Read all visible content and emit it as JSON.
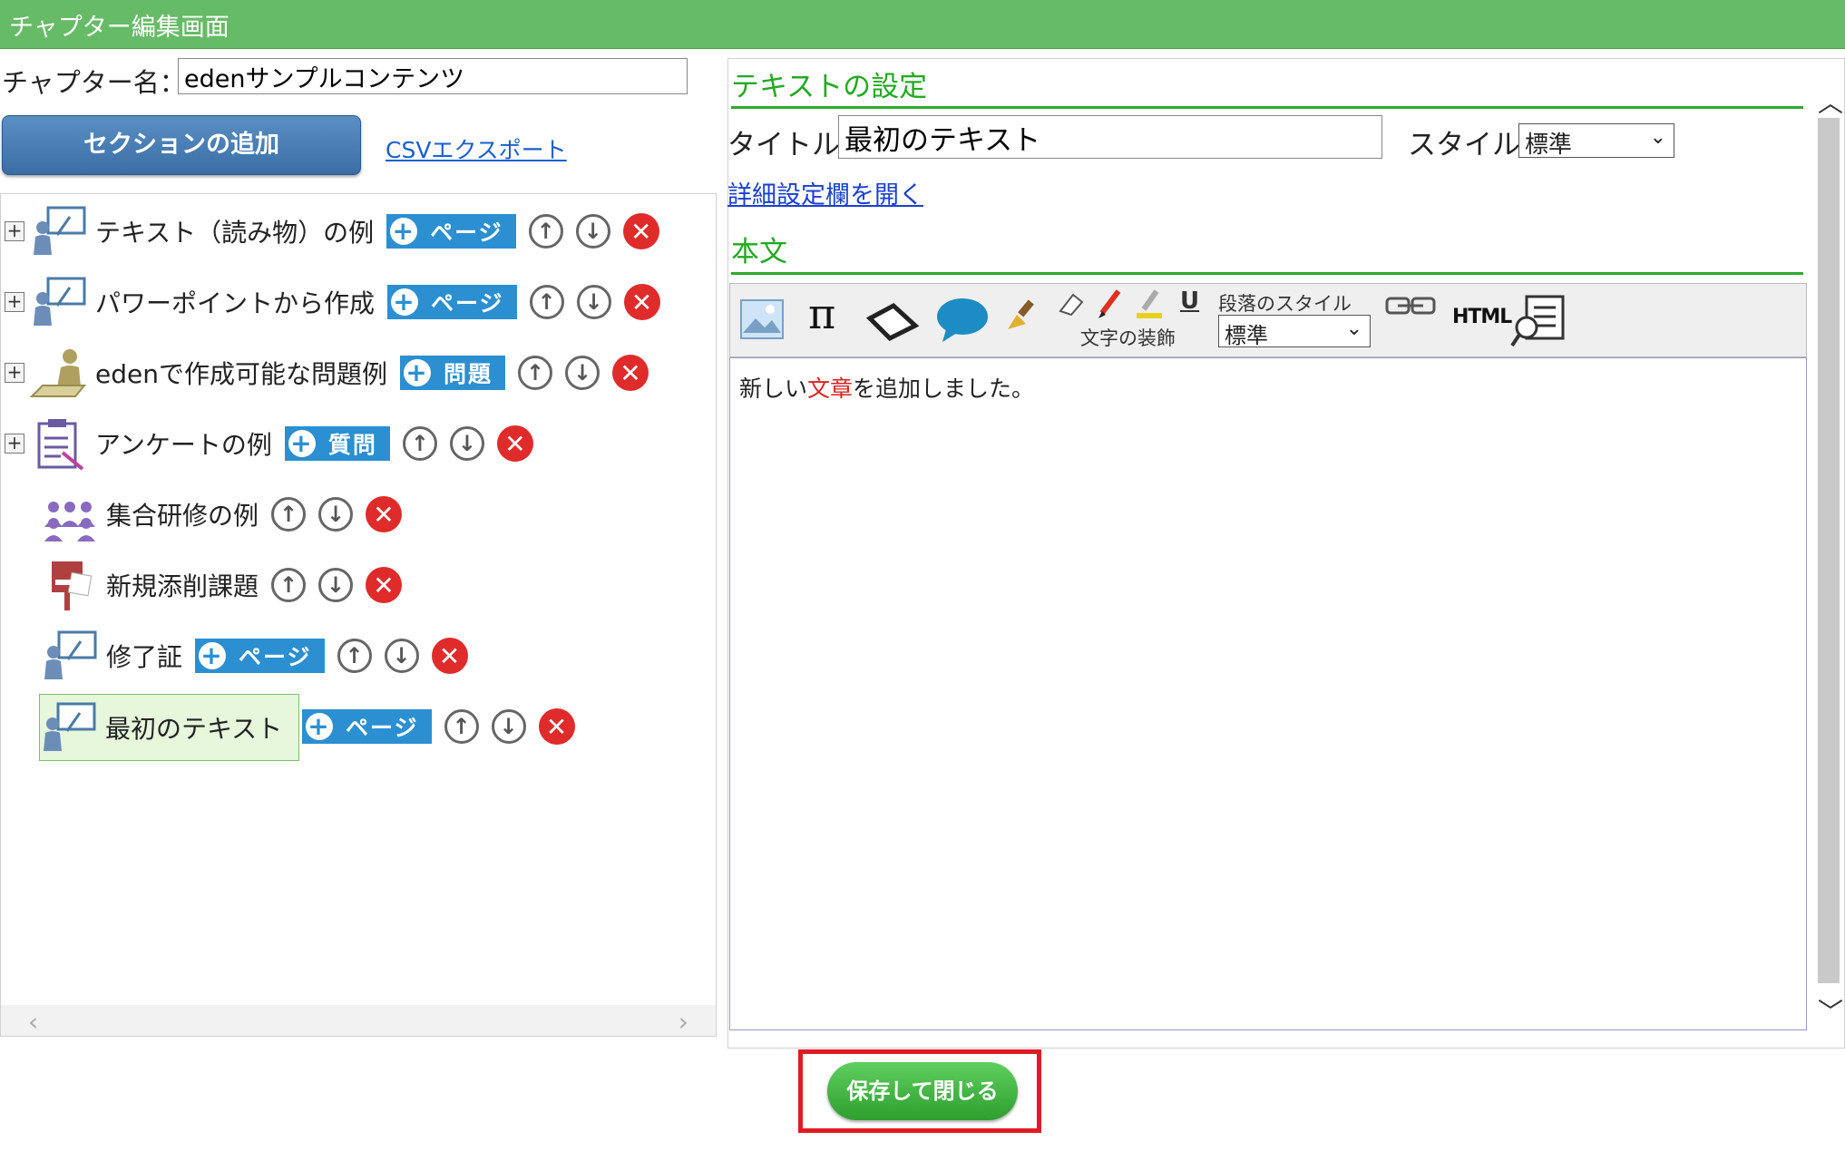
{
  "header": {
    "title": "チャプター編集画面"
  },
  "chapter": {
    "label": "チャプター名：",
    "value": "edenサンプルコンテンツ"
  },
  "buttons": {
    "add_section": "セクションの追加",
    "csv_export": "CSVエクスポート",
    "save_close": "保存して閉じる"
  },
  "tree": {
    "items": [
      {
        "label": "テキスト（読み物）の例",
        "add": "ページ"
      },
      {
        "label": "パワーポイントから作成",
        "add": "ページ"
      },
      {
        "label": "edenで作成可能な問題例",
        "add": "問題"
      },
      {
        "label": "アンケートの例",
        "add": "質問"
      },
      {
        "label": "集合研修の例"
      },
      {
        "label": "新規添削課題"
      },
      {
        "label": "修了証",
        "add": "ページ"
      },
      {
        "label": "最初のテキスト",
        "add": "ページ"
      }
    ]
  },
  "text_settings": {
    "heading": "テキストの設定",
    "title_label": "タイトル:",
    "title_value": "最初のテキスト",
    "style_label": "スタイル:",
    "style_value": "標準",
    "detail_link": "詳細設定欄を開く",
    "body_heading": "本文"
  },
  "toolbar": {
    "decoration_label": "文字の装飾",
    "paragraph_label": "段落のスタイル",
    "paragraph_value": "標準",
    "html_label": "HTML",
    "pi": "π",
    "underline": "U"
  },
  "editor": {
    "text_before": "新しい",
    "text_red": "文章",
    "text_after": "を追加しました。"
  },
  "colors": {
    "header": "#66bb66",
    "accent_green": "#22aa22",
    "button_blue": "#3a6ea5",
    "add_blue": "#2b8fd1",
    "delete_red": "#e02b2b",
    "highlight": "#e01b24"
  }
}
